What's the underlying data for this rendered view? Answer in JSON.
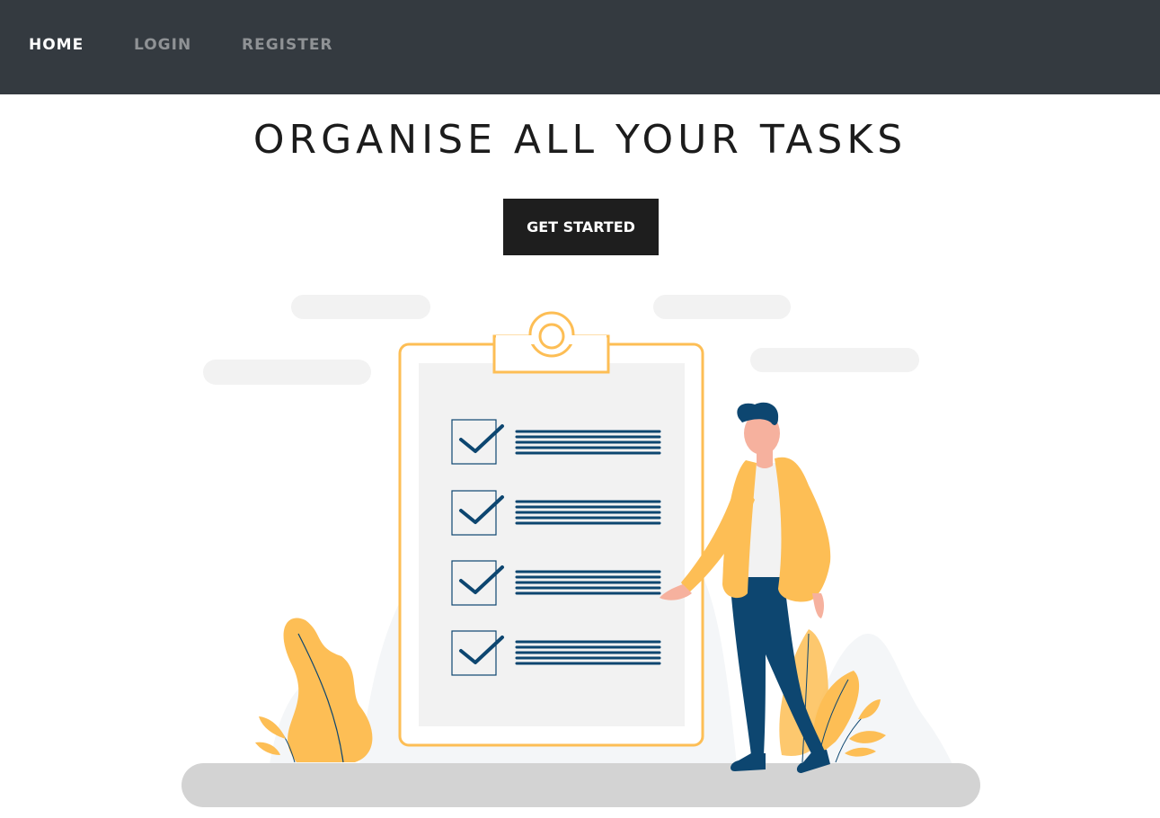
{
  "nav": {
    "items": [
      {
        "label": "HOME",
        "active": true
      },
      {
        "label": "LOGIN",
        "active": false
      },
      {
        "label": "REGISTER",
        "active": false
      }
    ]
  },
  "hero": {
    "title": "ORGANISE ALL YOUR TASKS",
    "cta_label": "GET STARTED"
  },
  "illustration": {
    "subject": "person-with-task-checklist",
    "checklist_items": 4,
    "colors": {
      "navbar": "#343a40",
      "accent_yellow": "#fdbe55",
      "navy": "#0d4670",
      "light_gray": "#f2f2f2",
      "ground": "#d3d3d3"
    }
  }
}
